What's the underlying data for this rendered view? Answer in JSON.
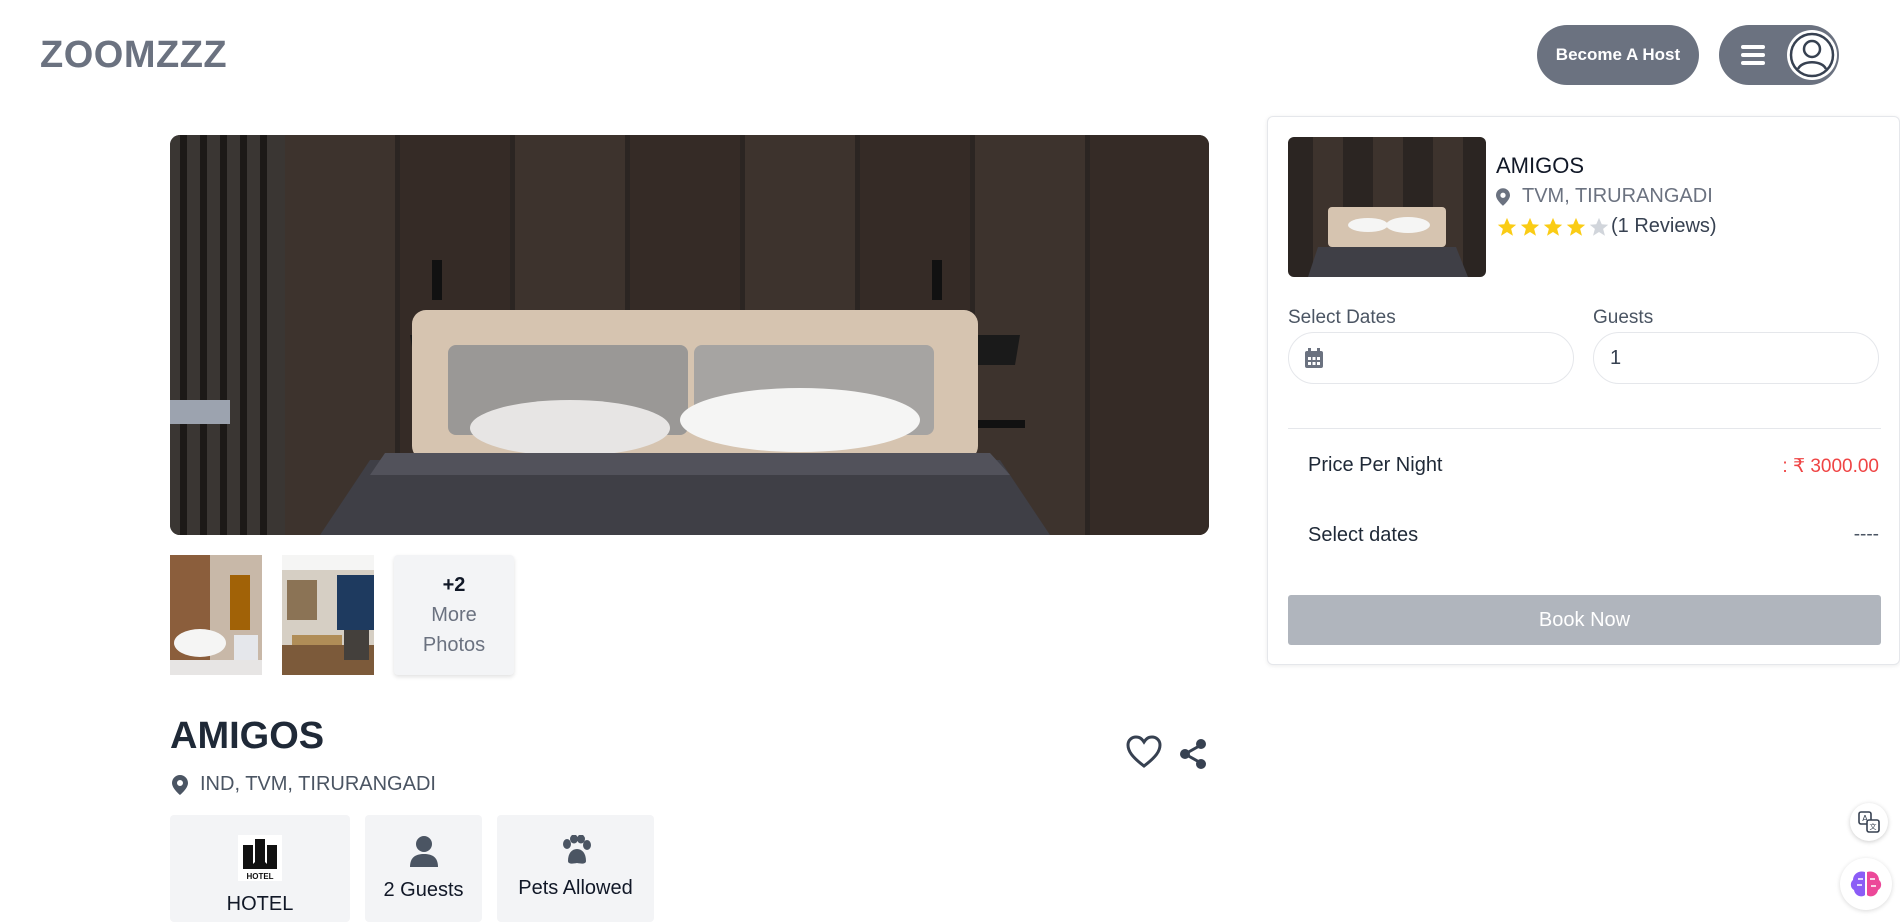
{
  "header": {
    "logo": "ZOOMZZZ",
    "become_host_label": "Become A Host",
    "menu_icon": "hamburger-icon",
    "avatar_icon": "user-circle-icon"
  },
  "gallery": {
    "more_count": "+2",
    "more_line1": "More",
    "more_line2": "Photos"
  },
  "listing": {
    "name": "AMIGOS",
    "location": "IND, TVM, TIRURANGADI",
    "features": [
      {
        "icon": "hotel-icon",
        "label": "HOTEL"
      },
      {
        "icon": "user-icon",
        "label": "2 Guests"
      },
      {
        "icon": "paw-icon",
        "label": "Pets Allowed"
      }
    ]
  },
  "booking": {
    "name": "AMIGOS",
    "location": "TVM, TIRURANGADI",
    "rating": 4,
    "rating_max": 5,
    "reviews": "(1 Reviews)",
    "select_dates_label": "Select Dates",
    "guests_label": "Guests",
    "guests_value": "1",
    "price_label": "Price Per Night",
    "price_value": ": ₹ 3000.00",
    "dates_label": "Select dates",
    "dates_value": "----",
    "book_label": "Book Now"
  },
  "colors": {
    "accent": "#6b7280",
    "price": "#ef4444",
    "star": "#facc15",
    "button_disabled": "#b0b5bd"
  }
}
